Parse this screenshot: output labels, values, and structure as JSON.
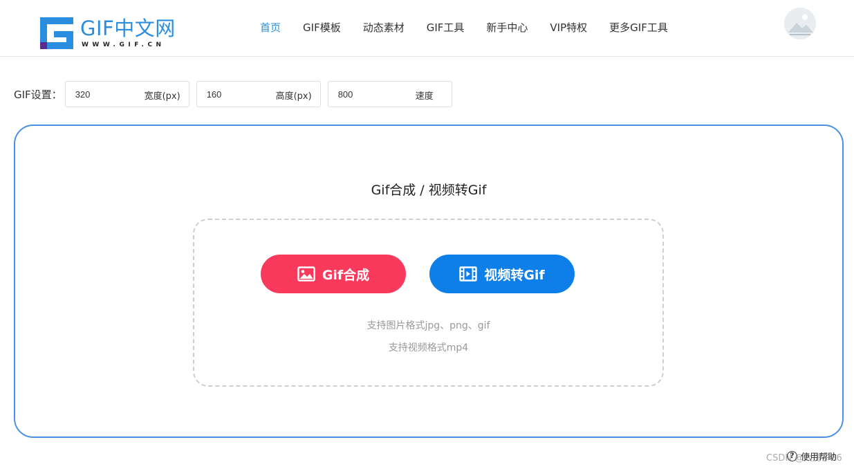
{
  "header": {
    "logo_text": "GIF中文网",
    "logo_sub": "WWW.GIF.CN",
    "nav": [
      {
        "label": "首页",
        "active": true
      },
      {
        "label": "GIF模板",
        "active": false
      },
      {
        "label": "动态素材",
        "active": false
      },
      {
        "label": "GIF工具",
        "active": false
      },
      {
        "label": "新手中心",
        "active": false
      },
      {
        "label": "VIP特权",
        "active": false
      },
      {
        "label": "更多GIF工具",
        "active": false
      }
    ]
  },
  "settings": {
    "label": "GIF设置：",
    "width": {
      "value": "320",
      "suffix": "宽度(px)"
    },
    "height": {
      "value": "160",
      "suffix": "高度(px)"
    },
    "speed": {
      "value": "800",
      "suffix": "速度"
    }
  },
  "panel": {
    "title": "Gif合成 / 视频转Gif",
    "gif_button": "Gif合成",
    "video_button": "视频转Gif",
    "hint_image": "支持图片格式jpg、png、gif",
    "hint_video": "支持视频格式mp4"
  },
  "help": {
    "icon_glyph": "?",
    "label": "使用帮助"
  },
  "watermark": "CSDN @大房子66",
  "colors": {
    "accent_blue": "#2b8de0",
    "panel_border": "#4a90e2",
    "gif_button": "#fa3a5d",
    "video_button": "#0e7fe8"
  }
}
